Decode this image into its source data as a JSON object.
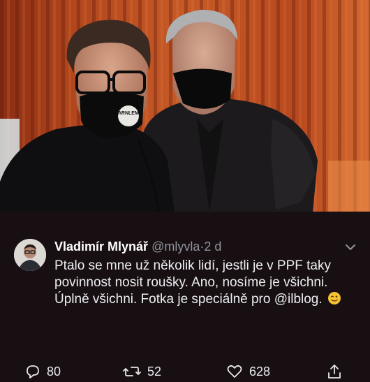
{
  "tweet": {
    "author_name": "Vladimír Mlynář",
    "author_handle": "@mlyvla",
    "separator": "·",
    "timestamp": "2 d",
    "text": "Ptalo se mne už několik lidí, jestli je v PPF taky povinnost nosit roušky. Ano, nosíme je všichni. Úplně všichni. Fotka je speciálně pro @ilblog.",
    "emoji": "winking-face"
  },
  "actions": {
    "reply_count": "80",
    "retweet_count": "52",
    "like_count": "628"
  },
  "colors": {
    "background": "#180f13",
    "name_text": "#ffffff",
    "secondary_text": "#8f969c",
    "body_text": "#eceff1",
    "curtain": "#b5481e"
  },
  "mask_print": "ΛRNLEM"
}
